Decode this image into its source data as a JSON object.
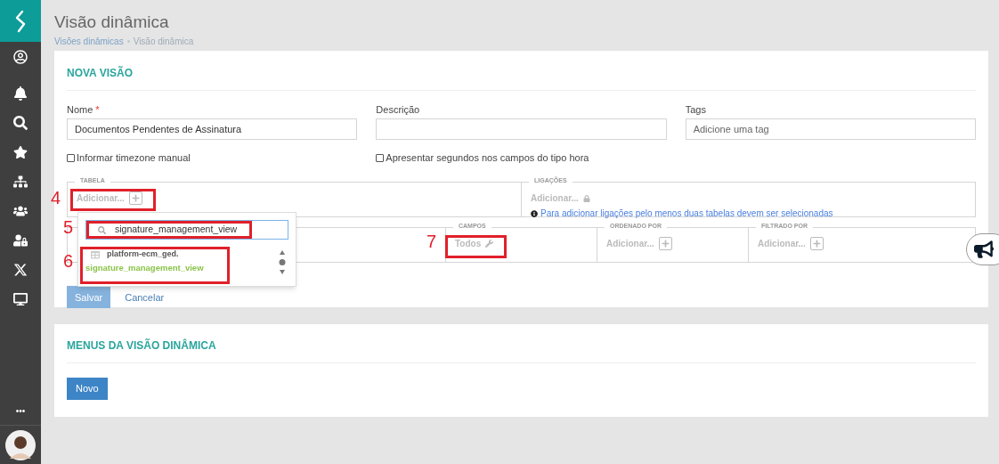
{
  "sidebar": {
    "more": "•••"
  },
  "page": {
    "title": "Visão dinâmica",
    "breadcrumb": [
      {
        "label": "Visões dinâmicas",
        "link": true
      },
      {
        "label": "Visão dinâmica",
        "link": false
      }
    ]
  },
  "form_card": {
    "title": "NOVA VISÃO",
    "fields": [
      {
        "label": "Nome",
        "required_mark": "*",
        "value": "Documentos Pendentes de Assinatura"
      },
      {
        "label": "Descrição"
      },
      {
        "label": "Tags",
        "placeholder": "Adicione uma tag"
      }
    ],
    "checkboxes": [
      {
        "label": "Informar timezone manual",
        "checked": false
      },
      {
        "label": "Apresentar segundos nos campos do tipo hora",
        "checked": false
      }
    ],
    "builder_rows": [
      [
        {
          "legend": "TABELA",
          "action": "Adicionar...",
          "kind": "plus"
        },
        {
          "legend": "LIGAÇÕES",
          "action": "Adicionar...",
          "kind": "lock",
          "info": "Para adicionar ligações pelo menos duas tabelas devem ser selecionadas"
        }
      ],
      [
        {
          "kind": "hidden"
        },
        {
          "legend": "CAMPOS",
          "action": "Todos",
          "kind": "wrench"
        },
        {
          "legend": "ORDENADO POR",
          "action": "Adicionar...",
          "kind": "plus"
        },
        {
          "legend": "FILTRADO POR",
          "action": "Adicionar...",
          "kind": "plus"
        }
      ]
    ],
    "buttons": [
      {
        "label": "Salvar",
        "kind": "primary"
      },
      {
        "label": "Cancelar",
        "kind": "link"
      }
    ]
  },
  "dropdown": {
    "search_value": "signature_management_view",
    "results": [
      {
        "schema": "platform-ecm_ged.",
        "name": "signature_management_view"
      }
    ]
  },
  "menus_card": {
    "title": "MENUS DA VISÃO DINÂMICA",
    "button": "Novo"
  },
  "annotations": [
    {
      "label": "4"
    },
    {
      "label": "5"
    },
    {
      "label": "6"
    },
    {
      "label": "7"
    }
  ]
}
